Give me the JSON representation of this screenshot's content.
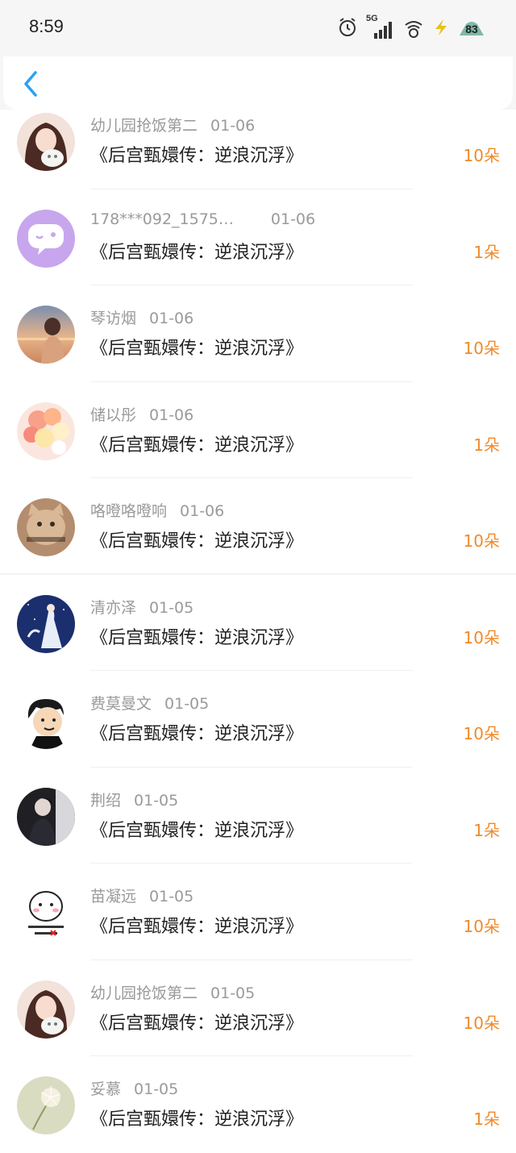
{
  "status_bar": {
    "time": "8:59",
    "network": "5G",
    "battery": "83",
    "icons": [
      "alarm-icon",
      "signal-icon",
      "wifi-icon",
      "charging-icon",
      "battery-icon"
    ]
  },
  "header": {
    "back_icon": "chevron-left-icon",
    "accent_color": "#2aa1f3"
  },
  "colors": {
    "amount": "#f08a2a",
    "meta": "#9a9a9a",
    "title": "#222222"
  },
  "gifts": [
    {
      "name": "幼儿园抢饭第二",
      "date": "01-06",
      "title": "《后宫甄嬛传：逆浪沉浮》",
      "amount": "10朵",
      "avatar": "avatar-girl-with-cat"
    },
    {
      "name": "178***092_1575…",
      "date": "01-06",
      "title": "《后宫甄嬛传：逆浪沉浮》",
      "amount": "1朵",
      "avatar": "avatar-purple-chat-bubble"
    },
    {
      "name": "琴访烟",
      "date": "01-06",
      "title": "《后宫甄嬛传：逆浪沉浮》",
      "amount": "10朵",
      "avatar": "avatar-sunset-person"
    },
    {
      "name": "储以彤",
      "date": "01-06",
      "title": "《后宫甄嬛传：逆浪沉浮》",
      "amount": "1朵",
      "avatar": "avatar-balloons"
    },
    {
      "name": "咯噔咯噔响",
      "date": "01-06",
      "title": "《后宫甄嬛传：逆浪沉浮》",
      "amount": "10朵",
      "avatar": "avatar-cat-meme"
    },
    {
      "name": "清亦泽",
      "date": "01-05",
      "title": "《后宫甄嬛传：逆浪沉浮》",
      "amount": "10朵",
      "avatar": "avatar-night-figure"
    },
    {
      "name": "费莫曼文",
      "date": "01-05",
      "title": "《后宫甄嬛传：逆浪沉浮》",
      "amount": "10朵",
      "avatar": "avatar-cartoon-man"
    },
    {
      "name": "荆绍",
      "date": "01-05",
      "title": "《后宫甄嬛传：逆浪沉浮》",
      "amount": "1朵",
      "avatar": "avatar-dark-portrait"
    },
    {
      "name": "苗凝远",
      "date": "01-05",
      "title": "《后宫甄嬛传：逆浪沉浮》",
      "amount": "10朵",
      "avatar": "avatar-sticker-face"
    },
    {
      "name": "幼儿园抢饭第二",
      "date": "01-05",
      "title": "《后宫甄嬛传：逆浪沉浮》",
      "amount": "10朵",
      "avatar": "avatar-girl-with-cat"
    },
    {
      "name": "妥慕",
      "date": "01-05",
      "title": "《后宫甄嬛传：逆浪沉浮》",
      "amount": "1朵",
      "avatar": "avatar-dandelion"
    }
  ]
}
